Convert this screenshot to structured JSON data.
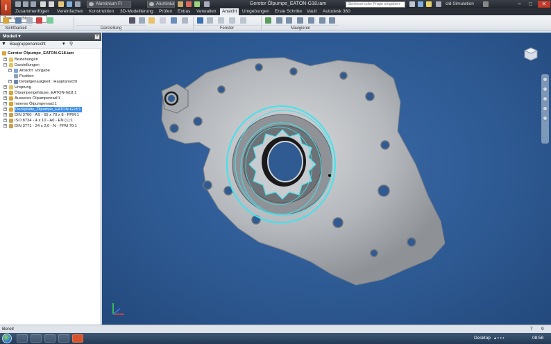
{
  "title_bar": {
    "logo_letter": "I",
    "doc_tab_1": "Aluminium Fl",
    "doc_tab_2": "Aluminiur",
    "window_title": "Gerotor Ölpumpe_EATON-G18.iam",
    "search_placeholder": "Stichwort oder Frage eingeben",
    "user": "cld-Simulation",
    "buttons": {
      "minimize": "–",
      "maximize": "□",
      "close": "✕"
    }
  },
  "ribbon_tabs": [
    "Zusammenfügen",
    "Vereinfachen",
    "Konstruktion",
    "3D-Modellierung",
    "Prüfen",
    "Extras",
    "Verwalten",
    "Ansicht",
    "Umgebungen",
    "Erste Schritte",
    "Vault",
    "Autodesk 360"
  ],
  "active_tab": "Ansicht",
  "ribbon": {
    "visual_style": "Zwei Leuchten",
    "groups": [
      "Sichtbarkeit",
      "Darstellung",
      "Fenster",
      "Navigieren"
    ]
  },
  "browser": {
    "header": "Modell",
    "view_mode": "Baugruppenansicht",
    "tree": [
      {
        "label": "Gerotor Ölpumpe_EATON-G18.iam",
        "level": 0,
        "bold": true
      },
      {
        "label": "Beziehungen",
        "level": 1
      },
      {
        "label": "Darstellungen",
        "level": 1
      },
      {
        "label": "Ansicht: Vorgabe",
        "level": 2
      },
      {
        "label": "Position",
        "level": 2
      },
      {
        "label": "Detailgenauigkeit : Hauptansicht",
        "level": 2
      },
      {
        "label": "Ursprung",
        "level": 1
      },
      {
        "label": "Ölpumpengehäuse_EATON-G18:1",
        "level": 1
      },
      {
        "label": "Äusseres Ölpumpenrad:1",
        "level": 1
      },
      {
        "label": "Inneres Ölpumpenrad:1",
        "level": 1
      },
      {
        "label": "Deckplatte_Ölpumpe_EATON-G18:1",
        "level": 1,
        "selected": true
      },
      {
        "label": "DIN 3760 - AS - 55 x 70 x 8 - FPM:1",
        "level": 1
      },
      {
        "label": "ISO 8734 - 4 x 10 - A0 - EN (1):1",
        "level": 1
      },
      {
        "label": "DIN 3771 - 24 x 2,0 - N - FPM 70:1",
        "level": 1
      }
    ]
  },
  "status": {
    "text": "Bereit",
    "num1": "7",
    "num2": "9"
  },
  "taskbar": {
    "desktop_label": "Desktop",
    "time": "08:58"
  },
  "colors": {
    "viewport_bg": "#2e5a93",
    "selection": "#3d8ee6",
    "highlight_cyan": "#3fe3ef"
  }
}
